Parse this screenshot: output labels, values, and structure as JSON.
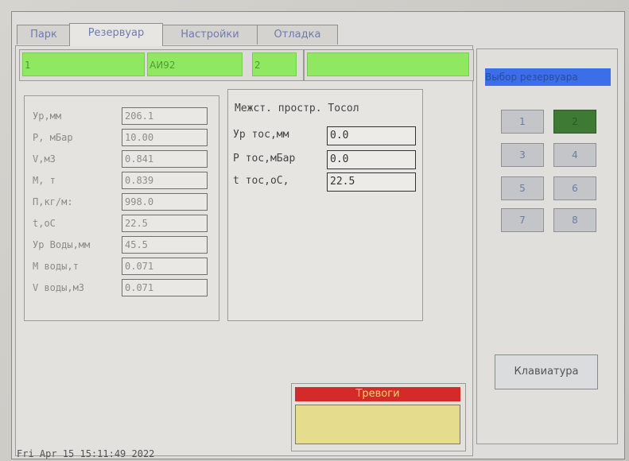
{
  "tabs": [
    {
      "label": "Парк"
    },
    {
      "label": "Резервуар"
    },
    {
      "label": "Настройки"
    },
    {
      "label": "Отладка"
    }
  ],
  "status_bar": {
    "tank_no": "1",
    "product": "АИ92",
    "field3": "2",
    "field4": ""
  },
  "tank_readings": [
    {
      "label": "Ур,мм",
      "value": "206.1"
    },
    {
      "label": "Р, мБар",
      "value": "10.00"
    },
    {
      "label": "V,м3",
      "value": "0.841"
    },
    {
      "label": "М, т",
      "value": "0.839"
    },
    {
      "label": "П,кг/м:",
      "value": "998.0"
    },
    {
      "label": "t,оС",
      "value": "22.5"
    },
    {
      "label": "Ур Воды,мм",
      "value": "45.5"
    },
    {
      "label": "М воды,т",
      "value": "0.071"
    },
    {
      "label": "V воды,м3",
      "value": "0.071"
    }
  ],
  "interspace": {
    "title": "Межст. простр. Тосол",
    "rows": [
      {
        "label": "Ур тос,мм",
        "value": "0.0"
      },
      {
        "label": "Р тос,мБар",
        "value": "0.0"
      },
      {
        "label": "t тос,оС,",
        "value": "22.5"
      }
    ]
  },
  "alarms": {
    "title": "Тревоги",
    "text": ""
  },
  "tank_select": {
    "title": "Выбор резервуара",
    "buttons": [
      "1",
      "2",
      "3",
      "4",
      "5",
      "6",
      "7",
      "8"
    ],
    "selected": "2"
  },
  "keyboard_label": "Клавиатура",
  "datetime": "Fri Apr 15 15:11:49 2022",
  "colors": {
    "status_green": "#8fe860",
    "alarm_red": "#d42a2a",
    "alarm_box": "#e6dc8e",
    "selected_btn": "#3f7a35",
    "select_title_bg": "#3b6ee8"
  }
}
